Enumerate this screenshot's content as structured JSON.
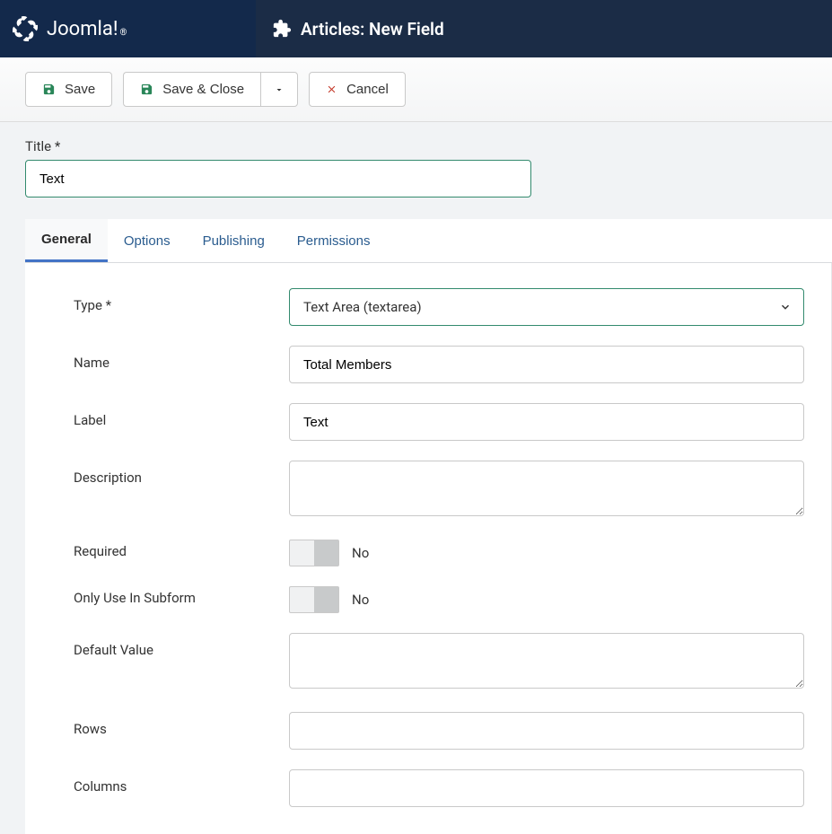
{
  "brand": {
    "name": "Joomla!",
    "registered": "®"
  },
  "page": {
    "title": "Articles: New Field"
  },
  "toolbar": {
    "save": "Save",
    "save_close": "Save & Close",
    "cancel": "Cancel"
  },
  "title_field": {
    "label": "Title *",
    "value": "Text"
  },
  "tabs": {
    "general": "General",
    "options": "Options",
    "publishing": "Publishing",
    "permissions": "Permissions"
  },
  "form": {
    "type": {
      "label": "Type *",
      "value": "Text Area (textarea)"
    },
    "name": {
      "label": "Name",
      "value": "Total Members"
    },
    "label_field": {
      "label": "Label",
      "value": "Text"
    },
    "description": {
      "label": "Description",
      "value": ""
    },
    "required": {
      "label": "Required",
      "value": "No"
    },
    "subform": {
      "label": "Only Use In Subform",
      "value": "No"
    },
    "default_value": {
      "label": "Default Value",
      "value": ""
    },
    "rows": {
      "label": "Rows",
      "value": ""
    },
    "columns": {
      "label": "Columns",
      "value": ""
    }
  }
}
